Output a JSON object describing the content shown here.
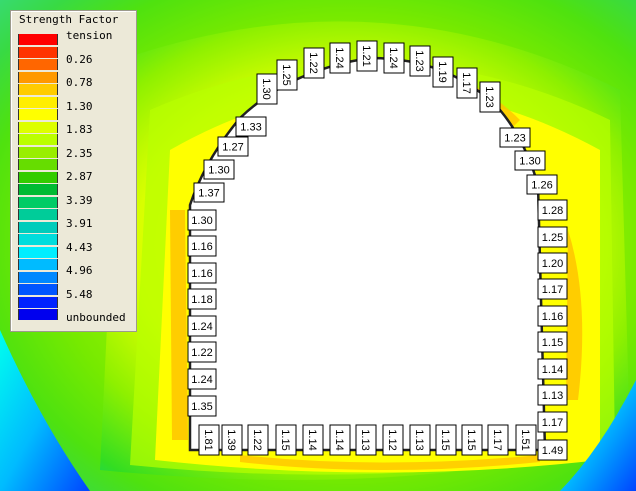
{
  "legend": {
    "title": "Strength Factor",
    "labels": [
      "tension",
      "0.26",
      "0.78",
      "1.30",
      "1.83",
      "2.35",
      "2.87",
      "3.39",
      "3.91",
      "4.43",
      "4.96",
      "5.48",
      "unbounded"
    ],
    "colors": [
      "#ff0000",
      "#ff3300",
      "#ff6600",
      "#ff9900",
      "#ffcc00",
      "#ffee00",
      "#ffff00",
      "#ddff00",
      "#bbff00",
      "#99ee00",
      "#66dd00",
      "#33cc00",
      "#00bb33",
      "#00cc66",
      "#00cc99",
      "#00ccbb",
      "#00dddd",
      "#00eeff",
      "#00bbff",
      "#0088ff",
      "#0055ff",
      "#0022ff",
      "#0000ee"
    ]
  },
  "colors": {
    "yellow": "#ffff00",
    "lime": "#c8ff00",
    "green": "#33dd00",
    "teal": "#00cc88",
    "cyan": "#00ffee",
    "blue": "#0066ff",
    "orange": "#ffc400"
  },
  "labels": {
    "bottom": [
      "1.81",
      "1.39",
      "1.22",
      "1.15",
      "1.14",
      "1.14",
      "1.13",
      "1.12",
      "1.13",
      "1.15",
      "1.15",
      "1.17",
      "1.51"
    ],
    "left": [
      "1.30",
      "1.16",
      "1.16",
      "1.18",
      "1.24",
      "1.22",
      "1.24",
      "1.35"
    ],
    "right": [
      "1.28",
      "1.25",
      "1.20",
      "1.17",
      "1.16",
      "1.15",
      "1.14",
      "1.13",
      "1.17",
      "1.49"
    ],
    "arc_left": [
      "1.37",
      "1.30",
      "1.27",
      "1.33"
    ],
    "arc_right": [
      "1.23",
      "1.30",
      "1.26"
    ],
    "crown": [
      "1.30",
      "1.25",
      "1.22",
      "1.24",
      "1.21",
      "1.24",
      "1.23",
      "1.19",
      "1.17",
      "1.23"
    ]
  }
}
